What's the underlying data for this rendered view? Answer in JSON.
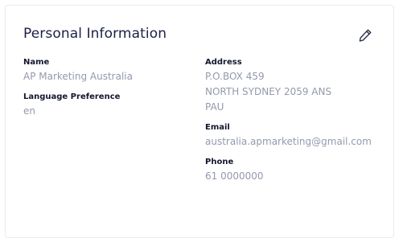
{
  "card": {
    "title": "Personal Information",
    "edit_icon": "pencil-icon"
  },
  "left": {
    "name_label": "Name",
    "name_value": "AP Marketing Australia",
    "language_label": "Language Preference",
    "language_value": "en"
  },
  "right": {
    "address_label": "Address",
    "address_lines": [
      "P.O.BOX 459",
      "NORTH SYDNEY 2059 ANS",
      "PAU"
    ],
    "email_label": "Email",
    "email_value": "australia.apmarketing@gmail.com",
    "phone_label": "Phone",
    "phone_value": "61 0000000"
  },
  "colors": {
    "title": "#1b2044",
    "label": "#14172e",
    "value": "#9499ad",
    "border": "#e9ebf1"
  }
}
